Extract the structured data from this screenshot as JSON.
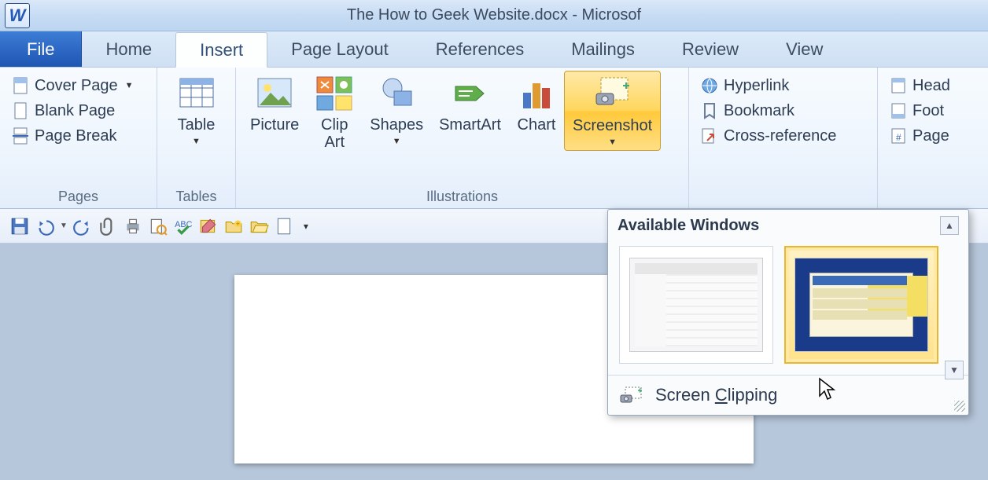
{
  "title": "The How to Geek Website.docx  -  Microsof",
  "tabs": {
    "file": "File",
    "home": "Home",
    "insert": "Insert",
    "page_layout": "Page Layout",
    "references": "References",
    "mailings": "Mailings",
    "review": "Review",
    "view": "View"
  },
  "groups": {
    "pages": {
      "label": "Pages",
      "cover_page": "Cover Page",
      "blank_page": "Blank Page",
      "page_break": "Page Break"
    },
    "tables": {
      "label": "Tables",
      "table": "Table"
    },
    "illustrations": {
      "label": "Illustrations",
      "picture": "Picture",
      "clip_art_line1": "Clip",
      "clip_art_line2": "Art",
      "shapes": "Shapes",
      "smartart": "SmartArt",
      "chart": "Chart",
      "screenshot": "Screenshot"
    },
    "links": {
      "hyperlink": "Hyperlink",
      "bookmark": "Bookmark",
      "cross_reference": "Cross-reference"
    },
    "header_footer": {
      "header": "Head",
      "footer": "Foot",
      "page_number": "Page"
    }
  },
  "dropdown": {
    "title": "Available Windows",
    "screen_clipping": "Screen Clipping",
    "clip_accel": "C"
  }
}
